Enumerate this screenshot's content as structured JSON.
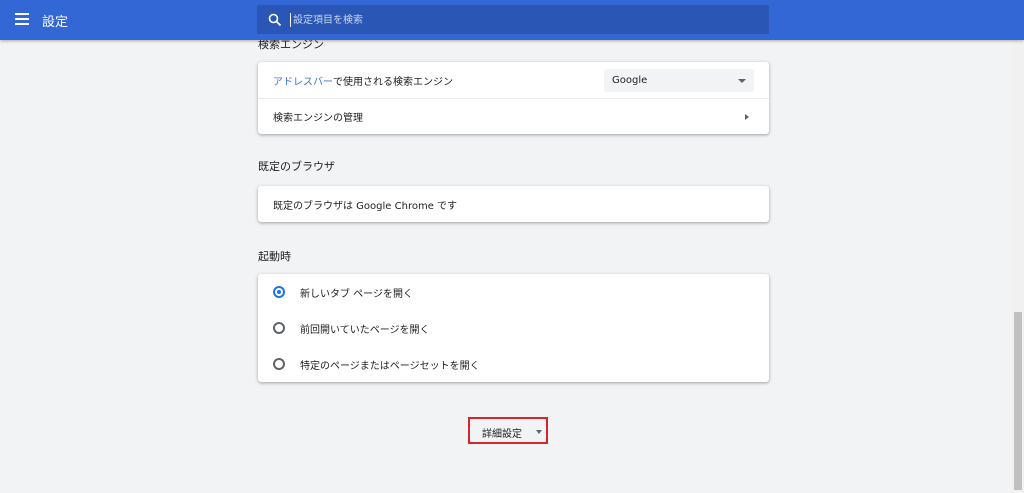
{
  "header": {
    "title": "設定",
    "menu_icon": "hamburger-menu-icon",
    "search_icon": "search-icon",
    "search_placeholder": "設定項目を検索"
  },
  "search_engine": {
    "section_title": "検索エンジン",
    "address_bar_link": "アドレスバー",
    "address_bar_suffix": "で使用される検索エンジン",
    "selected_engine": "Google",
    "manage_label": "検索エンジンの管理"
  },
  "default_browser": {
    "section_title": "既定のブラウザ",
    "status_text": "既定のブラウザは Google Chrome です"
  },
  "on_startup": {
    "section_title": "起動時",
    "options": [
      {
        "label": "新しいタブ ページを開く",
        "checked": true
      },
      {
        "label": "前回開いていたページを開く",
        "checked": false
      },
      {
        "label": "特定のページまたはページセットを開く",
        "checked": false
      }
    ]
  },
  "advanced": {
    "label": "詳細設定"
  },
  "colors": {
    "header_bg": "#3367d6",
    "accent": "#1a73e8",
    "highlight_border": "#d6262c"
  }
}
